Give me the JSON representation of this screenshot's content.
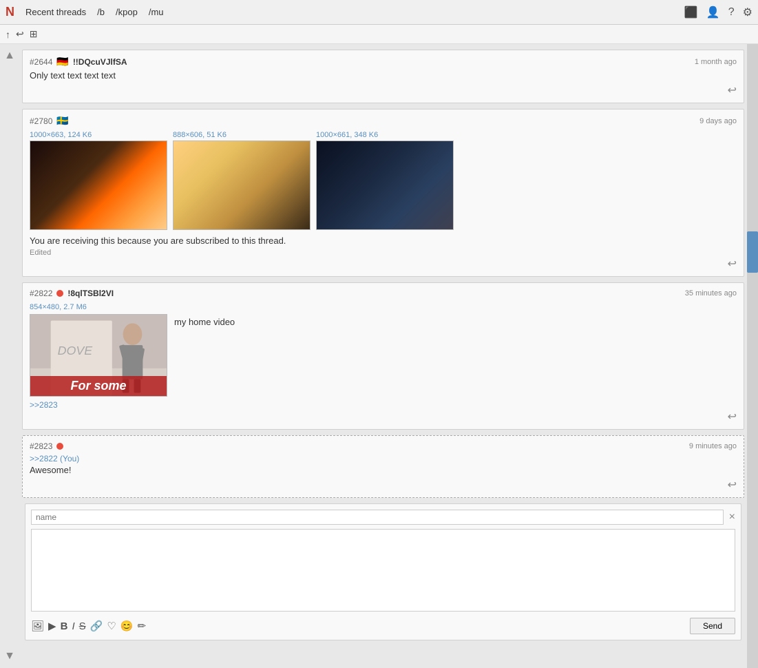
{
  "topbar": {
    "logo": "N",
    "nav": [
      {
        "label": "Recent threads",
        "id": "recent-threads"
      },
      {
        "label": "/b",
        "id": "b"
      },
      {
        "label": "/kpop",
        "id": "kpop"
      },
      {
        "label": "/mu",
        "id": "mu"
      }
    ],
    "icons": [
      "⬛",
      "👤",
      "?",
      "⚙"
    ]
  },
  "secondbar": {
    "icons": [
      "↑",
      "↩",
      "⊞"
    ]
  },
  "posts": [
    {
      "id": "#2644",
      "flag": "🇩🇪",
      "username": "!!DQcuVJlfSA",
      "time": "1 month ago",
      "content": "Only text text text text",
      "has_reply": true
    },
    {
      "id": "#2780",
      "flag": "🇸🇪",
      "username": "",
      "time": "9 days ago",
      "images": [
        {
          "label": "1000×663, 124 K6",
          "style": "car-img-1"
        },
        {
          "label": "888×606, 51 K6",
          "style": "car-img-2"
        },
        {
          "label": "1000×661, 348 K6",
          "style": "car-img-3"
        }
      ],
      "subscribed_text": "You are receiving this because you are subscribed to this thread.",
      "edited": true,
      "has_reply": true
    },
    {
      "id": "#2822",
      "dot": "red",
      "username": "!8qlTSBl2VI",
      "time": "35 minutes ago",
      "video_label": "854×480, 2.7 M6",
      "video_caption": "For some",
      "video_side_text": "my home video",
      "ref": ">>2823",
      "has_reply": true
    },
    {
      "id": "#2823",
      "dot": "red",
      "username": "",
      "time": "9 minutes ago",
      "quote_ref": ">>2822 (You)",
      "content": "Awesome!",
      "dashed": true,
      "has_reply": true
    }
  ],
  "reply_form": {
    "name_placeholder": "name",
    "close_label": "×",
    "send_label": "Send",
    "toolbar_icons": [
      "🖼",
      "▶",
      "B",
      "I",
      "S̶",
      "🔗",
      "♡",
      "😊",
      "✏"
    ]
  }
}
